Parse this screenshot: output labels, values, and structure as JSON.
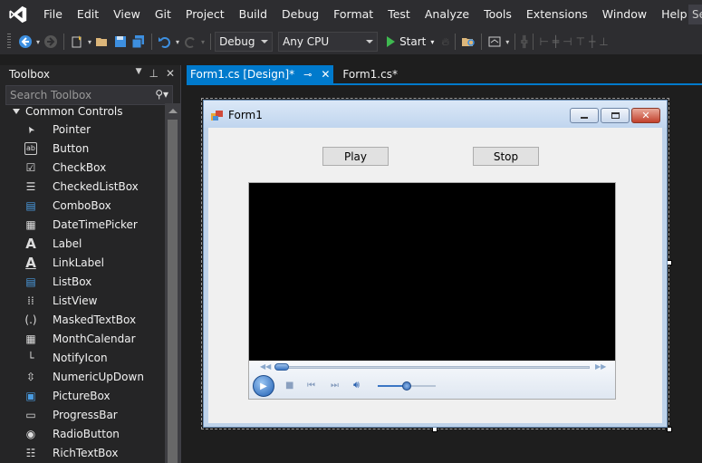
{
  "menu": {
    "items": [
      "File",
      "Edit",
      "View",
      "Git",
      "Project",
      "Build",
      "Debug",
      "Format",
      "Test",
      "Analyze",
      "Tools",
      "Extensions",
      "Window",
      "Help"
    ],
    "search_text": "Se"
  },
  "toolbar": {
    "config": "Debug",
    "platform": "Any CPU",
    "start_label": "Start"
  },
  "toolbox": {
    "title": "Toolbox",
    "search_placeholder": "Search Toolbox",
    "group": "Common Controls",
    "items": [
      {
        "label": "Pointer",
        "icon": "pointer-icon"
      },
      {
        "label": "Button",
        "icon": "button-icon"
      },
      {
        "label": "CheckBox",
        "icon": "checkbox-icon"
      },
      {
        "label": "CheckedListBox",
        "icon": "checkedlistbox-icon"
      },
      {
        "label": "ComboBox",
        "icon": "combobox-icon"
      },
      {
        "label": "DateTimePicker",
        "icon": "datetimepicker-icon"
      },
      {
        "label": "Label",
        "icon": "label-icon"
      },
      {
        "label": "LinkLabel",
        "icon": "linklabel-icon"
      },
      {
        "label": "ListBox",
        "icon": "listbox-icon"
      },
      {
        "label": "ListView",
        "icon": "listview-icon"
      },
      {
        "label": "MaskedTextBox",
        "icon": "maskedtextbox-icon"
      },
      {
        "label": "MonthCalendar",
        "icon": "monthcalendar-icon"
      },
      {
        "label": "NotifyIcon",
        "icon": "notifyicon-icon"
      },
      {
        "label": "NumericUpDown",
        "icon": "numericupdown-icon"
      },
      {
        "label": "PictureBox",
        "icon": "picturebox-icon"
      },
      {
        "label": "ProgressBar",
        "icon": "progressbar-icon"
      },
      {
        "label": "RadioButton",
        "icon": "radiobutton-icon"
      },
      {
        "label": "RichTextBox",
        "icon": "richtextbox-icon"
      }
    ]
  },
  "tabs": [
    {
      "label": "Form1.cs [Design]*",
      "active": true
    },
    {
      "label": "Form1.cs*",
      "active": false
    }
  ],
  "form": {
    "title": "Form1",
    "play_label": "Play",
    "stop_label": "Stop"
  },
  "colors": {
    "accent": "#007acc",
    "ide_bg": "#1e1e1e",
    "panel_bg": "#252526",
    "chrome_bg": "#2d2d30"
  }
}
